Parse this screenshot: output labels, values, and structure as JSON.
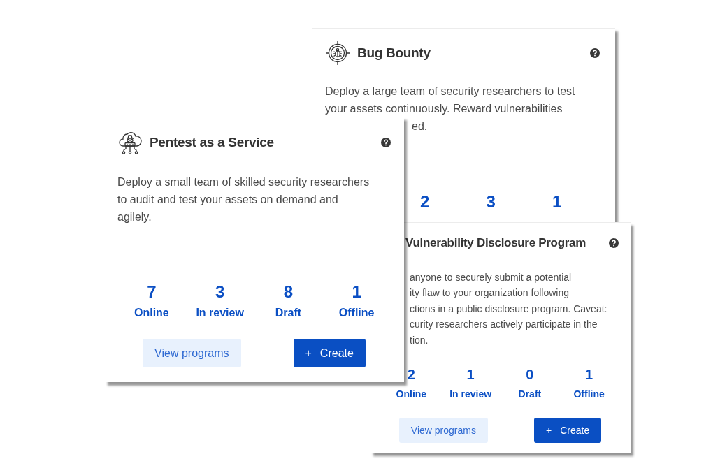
{
  "cards": [
    {
      "title": "Bug Bounty",
      "description": [
        "Deploy a large team of security researchers to test",
        "your assets continuously. Reward vulnerabilities",
        "ed."
      ],
      "stats": [
        {
          "count": "2"
        },
        {
          "count": "3"
        },
        {
          "count": "1"
        }
      ]
    },
    {
      "title": "Pentest as a Service",
      "description": [
        "Deploy a small team of skilled security researchers",
        "to audit and test your assets on demand and",
        "agilely."
      ],
      "stats": [
        {
          "count": "7",
          "label": "Online"
        },
        {
          "count": "3",
          "label": "In review"
        },
        {
          "count": "8",
          "label": "Draft"
        },
        {
          "count": "1",
          "label": "Offline"
        }
      ],
      "buttons": [
        {
          "kind": "secondary",
          "label": "View programs"
        },
        {
          "kind": "primary",
          "icon_text": "+",
          "label": "Create"
        }
      ]
    },
    {
      "title": "Vulnerability Disclosure Program",
      "description": [
        "anyone to securely submit a potential",
        "ity flaw to your organization following",
        "ctions in a public disclosure program. Caveat:",
        "curity researchers actively participate in the",
        "tion."
      ],
      "stats": [
        {
          "count": "2",
          "label": "Online"
        },
        {
          "count": "1",
          "label": "In review"
        },
        {
          "count": "0",
          "label": "Draft"
        },
        {
          "count": "1",
          "label": "Offline"
        }
      ],
      "buttons": [
        {
          "kind": "secondary",
          "label": "View programs"
        },
        {
          "kind": "primary",
          "icon_text": "+",
          "label": "Create"
        }
      ]
    }
  ]
}
